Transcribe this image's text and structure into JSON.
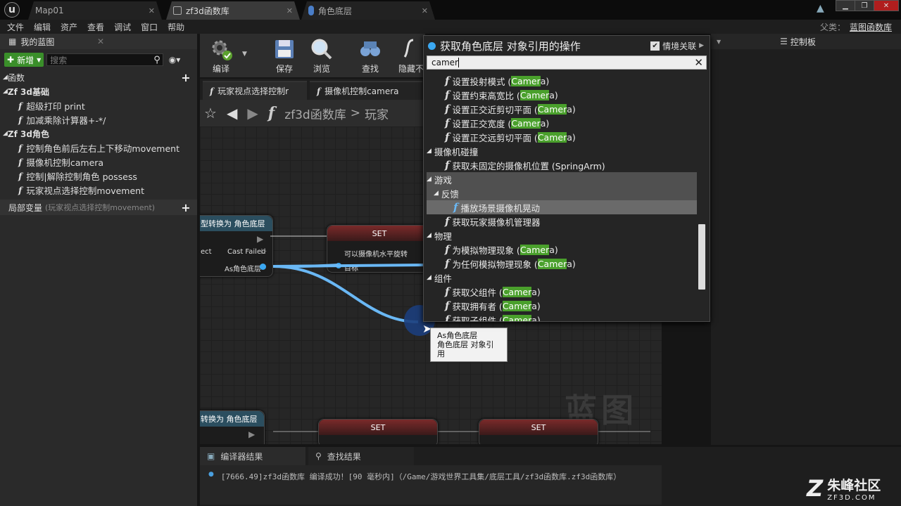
{
  "window": {
    "tabs": [
      {
        "label": "Map01",
        "state": "inactive"
      },
      {
        "label": "zf3d函数库",
        "state": "active"
      },
      {
        "label": "角色底层",
        "state": "inactive"
      }
    ],
    "parent_label": "父类：",
    "parent_value": "蓝图函数库"
  },
  "menubar": [
    "文件",
    "编辑",
    "资产",
    "查看",
    "调试",
    "窗口",
    "帮助"
  ],
  "my_blueprint": {
    "tab_label": "我的蓝图",
    "new_button": "新增",
    "search_placeholder": "搜索",
    "functions_header": "函数",
    "categories": [
      {
        "label": "Zf 3d基础",
        "items": [
          "超级打印 print",
          "加减乘除计算器+-*/"
        ]
      },
      {
        "label": "Zf 3d角色",
        "items": [
          "控制角色前后左右上下移动movement",
          "摄像机控制camera",
          "控制|解除控制角色 possess",
          "玩家视点选择控制movement"
        ]
      }
    ],
    "local_vars_label": "局部变量",
    "local_vars_scope": "(玩家视点选择控制movement)"
  },
  "toolbar": {
    "compile": "编译",
    "save": "保存",
    "browse": "浏览",
    "find": "查找",
    "hide": "隐藏不"
  },
  "doc_tabs": [
    "玩家视点选择控制r",
    "摄像机控制camera"
  ],
  "breadcrumb": {
    "library": "zf3d函数库",
    "separator": ">",
    "current": "玩家"
  },
  "graph": {
    "cast_node_title": "型转换为 角色底层",
    "cast_failed": "Cast Failed",
    "object_pin": "ect",
    "as_pin": "As角色底层",
    "set_label": "SET",
    "set_bool_pin": "可以摄像机水平旋转",
    "target_pin": "目标",
    "cast_node2_title": "转换为 角色底层",
    "watermark": "蓝图",
    "drag_tooltip_line1": "As角色底层",
    "drag_tooltip_line2": "角色底层 对象引用"
  },
  "control_panel": {
    "tab_label": "控制板"
  },
  "context_menu": {
    "title": "获取角色底层 对象引用的操作",
    "context_sensitive": "情境关联",
    "search_value": "camer",
    "entries": [
      {
        "type": "fn",
        "pre": "设置投射模式 (",
        "hl": "Camer",
        "post": "a)"
      },
      {
        "type": "fn",
        "pre": "设置约束高宽比 (",
        "hl": "Camer",
        "post": "a)"
      },
      {
        "type": "fn",
        "pre": "设置正交近剪切平面 (",
        "hl": "Camer",
        "post": "a)"
      },
      {
        "type": "fn",
        "pre": "设置正交宽度 (",
        "hl": "Camer",
        "post": "a)"
      },
      {
        "type": "fn",
        "pre": "设置正交远剪切平面 (",
        "hl": "Camer",
        "post": "a)"
      },
      {
        "type": "cat",
        "label": "摄像机碰撞"
      },
      {
        "type": "fn",
        "pre": "获取未固定的摄像机位置 (SpringArm)",
        "hl": "",
        "post": ""
      },
      {
        "type": "cat",
        "label": "游戏",
        "selected": true
      },
      {
        "type": "subcat",
        "label": "反馈",
        "selected": true
      },
      {
        "type": "fn2",
        "pre": "播放场景摄像机晃动",
        "hl": "",
        "post": "",
        "selected": true
      },
      {
        "type": "fn",
        "pre": "获取玩家摄像机管理器",
        "hl": "",
        "post": ""
      },
      {
        "type": "cat",
        "label": "物理"
      },
      {
        "type": "fn",
        "pre": "为模拟物理现象 (",
        "hl": "Camer",
        "post": "a)"
      },
      {
        "type": "fn",
        "pre": "为任何模拟物理现象 (",
        "hl": "Camer",
        "post": "a)"
      },
      {
        "type": "cat",
        "label": "组件"
      },
      {
        "type": "fn",
        "pre": "获取父组件 (",
        "hl": "Camer",
        "post": "a)"
      },
      {
        "type": "fn",
        "pre": "获取拥有者 (",
        "hl": "Camer",
        "post": "a)"
      },
      {
        "type": "fn",
        "pre": "获取子组件 (",
        "hl": "Camer",
        "post": "a)"
      }
    ]
  },
  "bottom": {
    "tab_compiler": "编译器结果",
    "tab_find": "查找结果",
    "log_line": "[7666.49]zf3d函数库 编译成功！[90 毫秒内]（/Game/游戏世界工具集/底层工具/zf3d函数库.zf3d函数库）"
  },
  "branding": {
    "name": "朱峰社区",
    "url": "ZF3D.COM"
  }
}
